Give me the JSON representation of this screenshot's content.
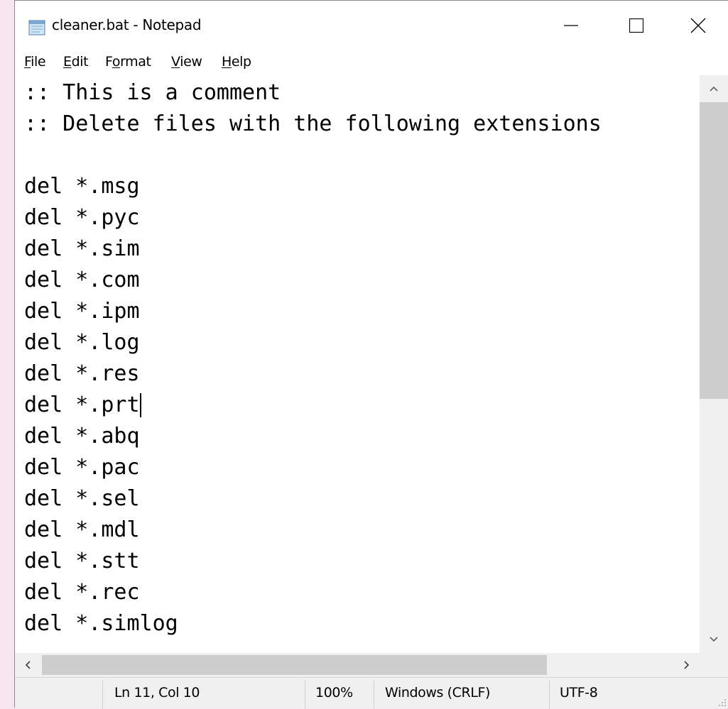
{
  "window": {
    "title": "cleaner.bat - Notepad",
    "controls": {
      "minimize": "minimize-icon",
      "maximize": "maximize-icon",
      "close": "close-icon"
    }
  },
  "menu": {
    "items": [
      {
        "accel": "F",
        "rest": "ile"
      },
      {
        "accel": "E",
        "rest": "dit"
      },
      {
        "pre": "F",
        "accel": "o",
        "rest": "rmat"
      },
      {
        "accel": "V",
        "rest": "iew"
      },
      {
        "accel": "H",
        "rest": "elp"
      }
    ]
  },
  "editor": {
    "lines": [
      ":: This is a comment",
      ":: Delete files with the following extensions",
      "",
      "del *.msg",
      "del *.pyc",
      "del *.sim",
      "del *.com",
      "del *.ipm",
      "del *.log",
      "del *.res",
      "del *.prt",
      "del *.abq",
      "del *.pac",
      "del *.sel",
      "del *.mdl",
      "del *.stt",
      "del *.rec",
      "del *.simlog"
    ],
    "caret": {
      "line": 11,
      "col": 10
    }
  },
  "statusbar": {
    "position": "Ln 11, Col 10",
    "zoom": "100%",
    "line_ending": "Windows (CRLF)",
    "encoding": "UTF-8"
  },
  "colors": {
    "background": "#f7e6ef",
    "scrollbar_track": "#f0f0f0",
    "scrollbar_thumb": "#cdcdcd"
  }
}
